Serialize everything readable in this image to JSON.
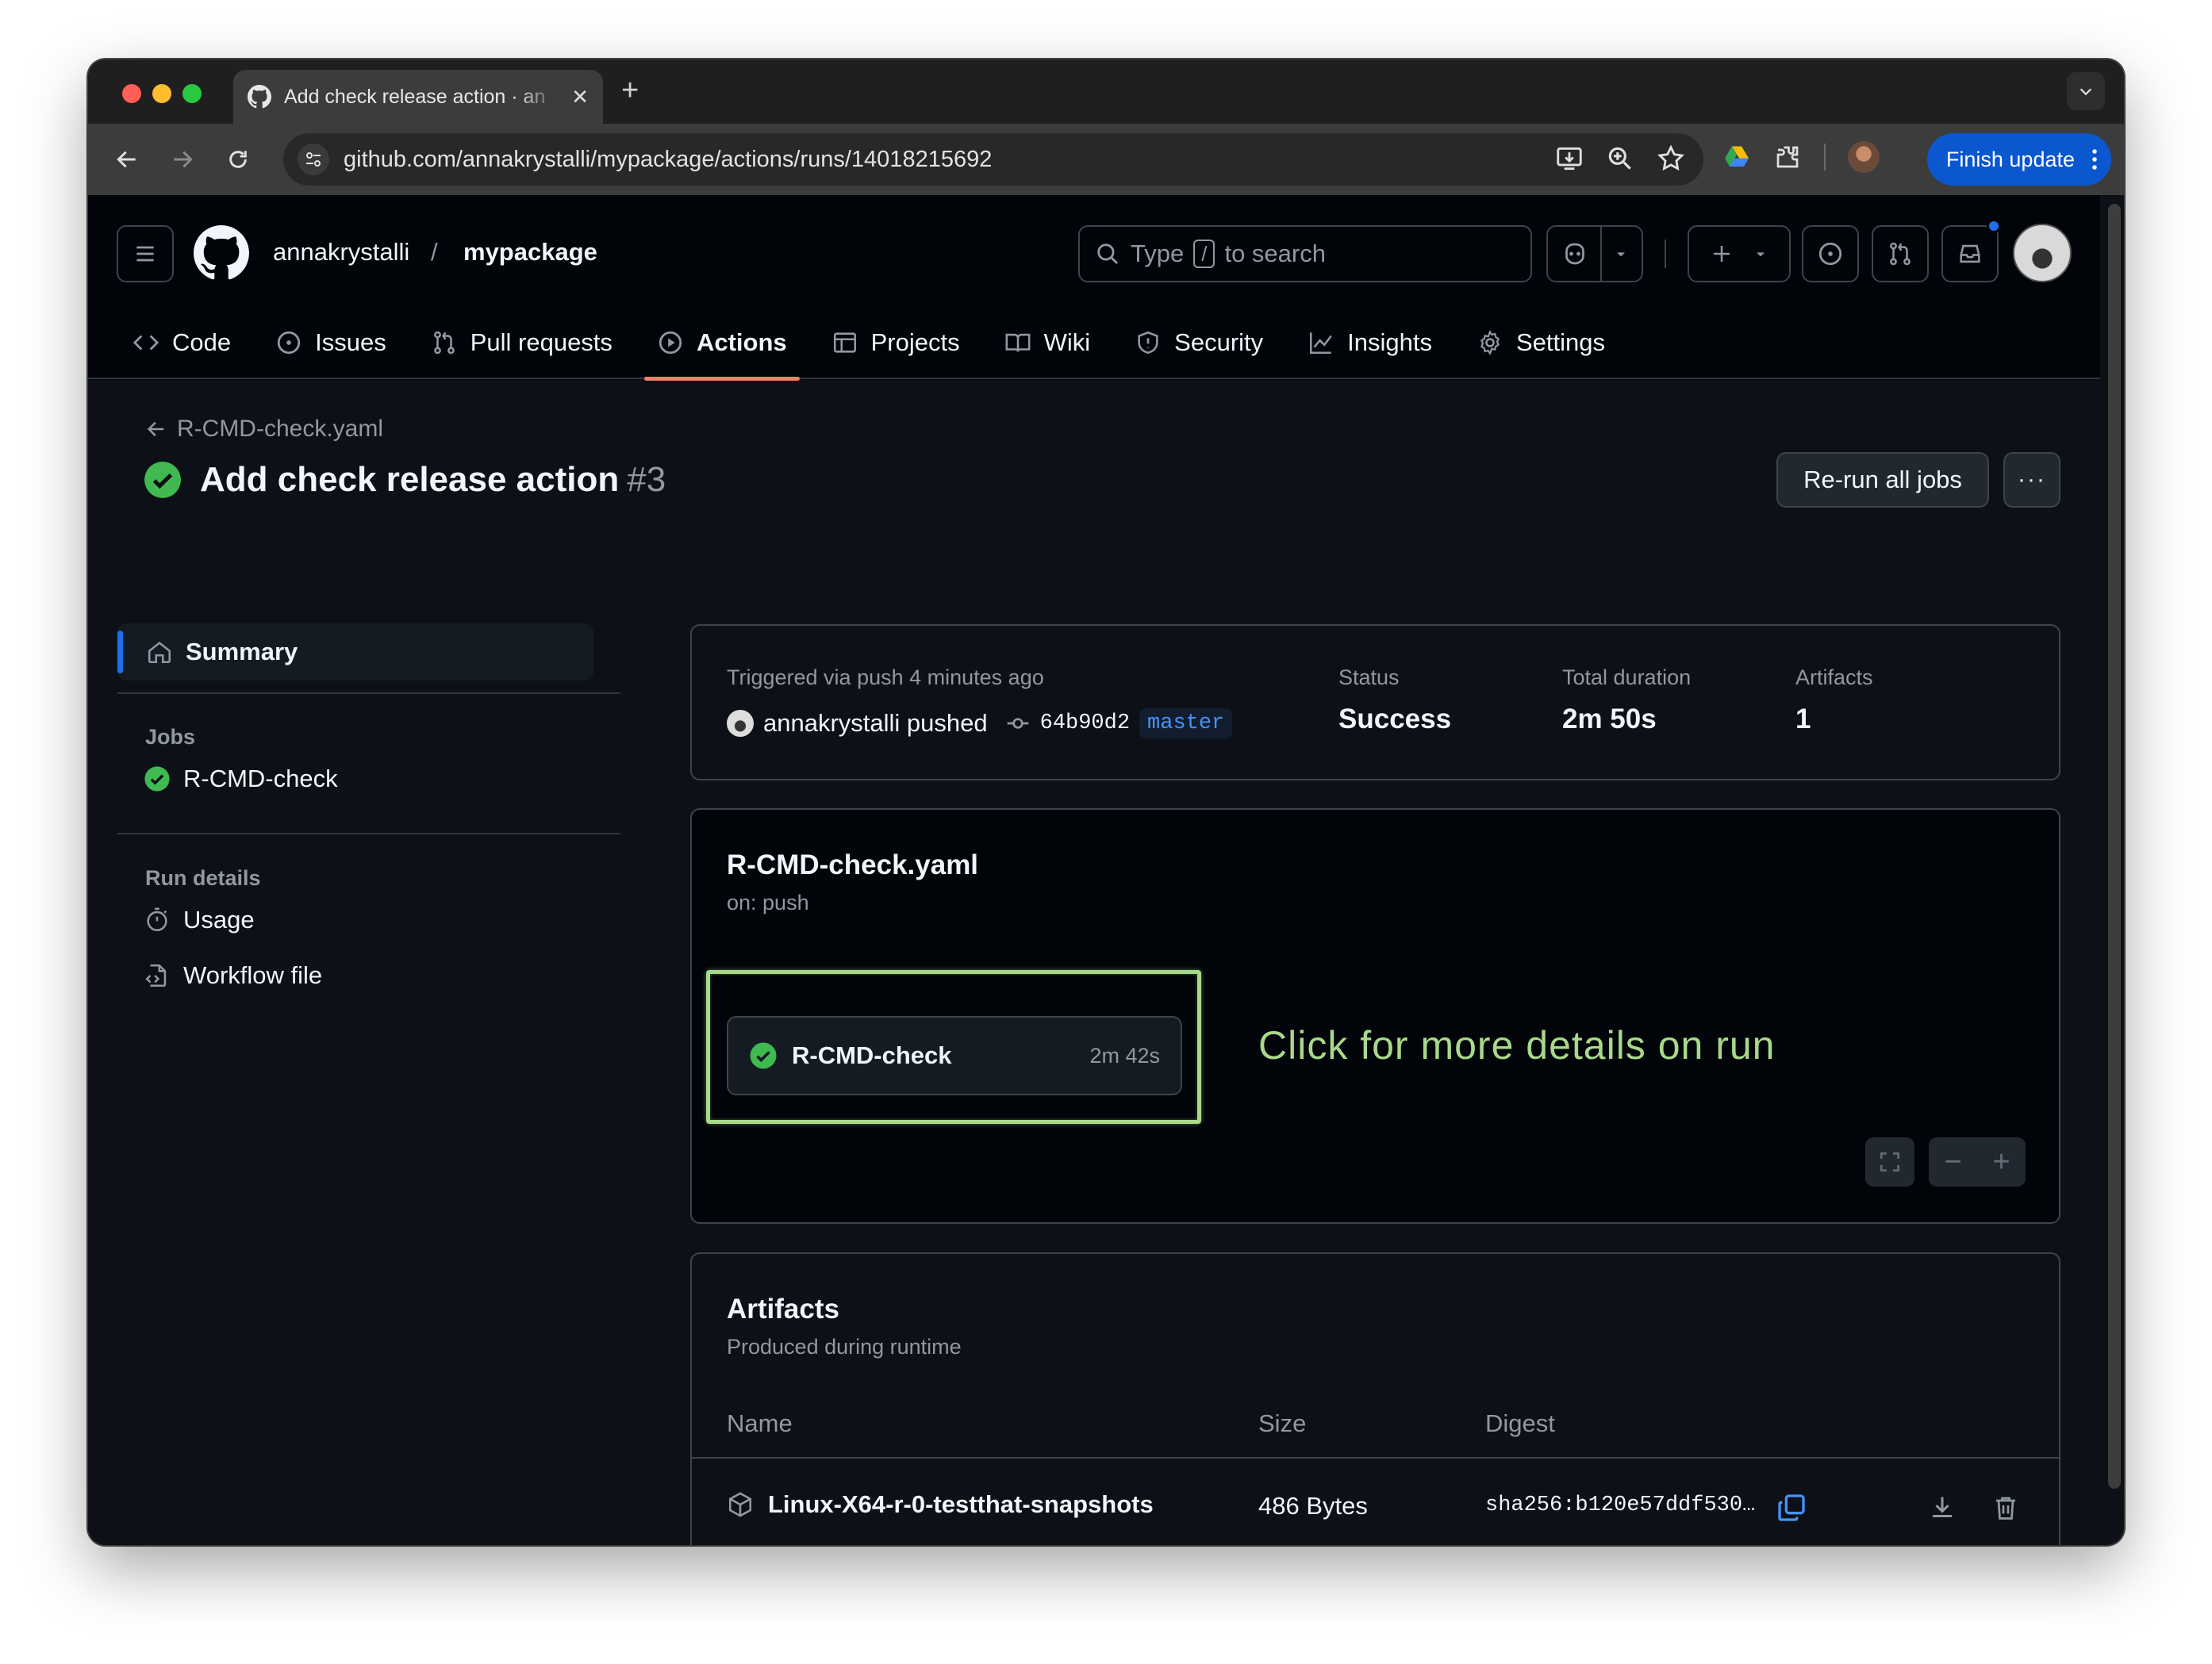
{
  "browser": {
    "tab_title": "Add check release action · an",
    "tab_close": "✕",
    "new_tab": "+",
    "url": "github.com/annakrystalli/mypackage/actions/runs/14018215692",
    "finish_update": "Finish update"
  },
  "header": {
    "owner": "annakrystalli",
    "slash": "/",
    "repo": "mypackage",
    "search_prefix": "Type",
    "search_key": "/",
    "search_suffix": "to search"
  },
  "repo_tabs": [
    {
      "label": "Code"
    },
    {
      "label": "Issues"
    },
    {
      "label": "Pull requests"
    },
    {
      "label": "Actions"
    },
    {
      "label": "Projects"
    },
    {
      "label": "Wiki"
    },
    {
      "label": "Security"
    },
    {
      "label": "Insights"
    },
    {
      "label": "Settings"
    }
  ],
  "run": {
    "back_label": "R-CMD-check.yaml",
    "title": "Add check release action",
    "number": "#3",
    "rerun_label": "Re-run all jobs",
    "more_label": "···"
  },
  "sidebar": {
    "summary": "Summary",
    "jobs_heading": "Jobs",
    "job": "R-CMD-check",
    "run_details_heading": "Run details",
    "usage": "Usage",
    "workflow_file": "Workflow file"
  },
  "summary": {
    "trigger": "Triggered via push 4 minutes ago",
    "pusher": "annakrystalli pushed",
    "sha": "64b90d2",
    "branch": "master",
    "status_label": "Status",
    "status_value": "Success",
    "duration_label": "Total duration",
    "duration_value": "2m 50s",
    "artifacts_label": "Artifacts",
    "artifacts_value": "1"
  },
  "workflow": {
    "name": "R-CMD-check.yaml",
    "on": "on: push",
    "job_name": "R-CMD-check",
    "job_duration": "2m 42s",
    "annotation": "Click for more details on run",
    "zoom_out": "−",
    "zoom_in": "+"
  },
  "artifacts": {
    "title": "Artifacts",
    "subtitle": "Produced during runtime",
    "col_name": "Name",
    "col_size": "Size",
    "col_digest": "Digest",
    "rows": [
      {
        "name": "Linux-X64-r-0-testthat-snapshots",
        "size": "486 Bytes",
        "digest": "sha256:b120e57ddf530…"
      }
    ]
  },
  "colors": {
    "success": "#3fb950",
    "accent": "#1f6feb",
    "active_tab_underline": "#f78166",
    "annotation": "#a8d98a"
  }
}
